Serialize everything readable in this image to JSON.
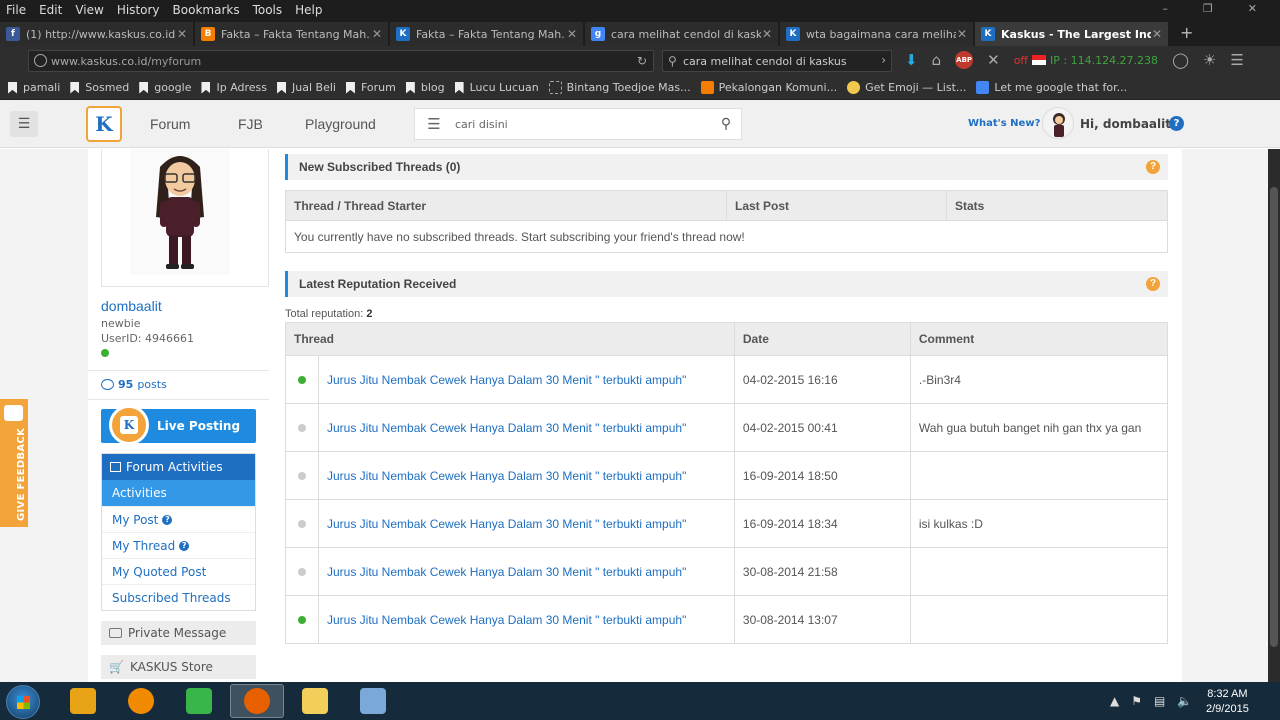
{
  "browser": {
    "menu": [
      "File",
      "Edit",
      "View",
      "History",
      "Bookmarks",
      "Tools",
      "Help"
    ],
    "tabs": [
      {
        "title": "(1) http://www.kaskus.co.id...",
        "favicon_color": "#3b5998",
        "favicon_glyph": "f",
        "active": false
      },
      {
        "title": "Fakta – Fakta Tentang Mah...",
        "favicon_color": "#f57d00",
        "favicon_glyph": "B",
        "active": false
      },
      {
        "title": "Fakta – Fakta Tentang Mah...",
        "favicon_color": "#1e6fc2",
        "favicon_glyph": "K",
        "active": false
      },
      {
        "title": "cara melihat cendol di kask...",
        "favicon_color": "#4285f4",
        "favicon_glyph": "g",
        "active": false
      },
      {
        "title": "wta bagaimana cara meliha...",
        "favicon_color": "#1e6fc2",
        "favicon_glyph": "K",
        "active": false
      },
      {
        "title": "Kaskus - The Largest Indo...",
        "favicon_color": "#1e6fc2",
        "favicon_glyph": "K",
        "active": true
      }
    ],
    "url_domain": "www.kaskus.co.id",
    "url_path": "/myforum",
    "search_query": "cara melihat cendol di kaskus",
    "ip_off": "off",
    "ip_text": "IP : 114.124.27.238",
    "bookmarks": [
      {
        "label": "pamali",
        "type": "folder"
      },
      {
        "label": "Sosmed",
        "type": "folder"
      },
      {
        "label": "google",
        "type": "folder"
      },
      {
        "label": "Ip Adress",
        "type": "folder"
      },
      {
        "label": "Jual Beli",
        "type": "folder"
      },
      {
        "label": "Forum",
        "type": "folder"
      },
      {
        "label": "blog",
        "type": "folder"
      },
      {
        "label": "Lucu Lucuan",
        "type": "folder"
      },
      {
        "label": "Bintang Toedjoe Mas...",
        "type": "page"
      },
      {
        "label": "Pekalongan Komuni...",
        "type": "blogger"
      },
      {
        "label": "Get Emoji — List...",
        "type": "emoji"
      },
      {
        "label": "Let me google that for...",
        "type": "lmgtfy"
      }
    ]
  },
  "header": {
    "logo_glyph": "K",
    "nav": [
      "Forum",
      "FJB",
      "Playground"
    ],
    "search_placeholder": "cari disini",
    "whats_new": "What's New?",
    "greeting": "Hi, dombaalit",
    "help": "?"
  },
  "feedback": {
    "label": "GIVE FEEDBACK"
  },
  "sidebar": {
    "username": "dombaalit",
    "rank": "newbie",
    "user_id": "UserID: 4946661",
    "posts_count": "95",
    "posts_label": "posts",
    "live_posting": "Live Posting",
    "menu_header": "Forum Activities",
    "menu_items": [
      {
        "label": "Activities",
        "active": true,
        "help": false
      },
      {
        "label": "My Post",
        "active": false,
        "help": true
      },
      {
        "label": "My Thread",
        "active": false,
        "help": true
      },
      {
        "label": "My Quoted Post",
        "active": false,
        "help": false
      },
      {
        "label": "Subscribed Threads",
        "active": false,
        "help": false
      }
    ],
    "private_message": "Private Message",
    "kaskus_store": "KASKUS Store"
  },
  "subscribed": {
    "title": "New Subscribed Threads (0)",
    "columns": [
      "Thread / Thread Starter",
      "Last Post",
      "Stats"
    ],
    "empty_text": "You currently have no subscribed threads. Start subscribing your friend's thread now!"
  },
  "reputation": {
    "title": "Latest Reputation Received",
    "total_label": "Total reputation:",
    "total_value": "2",
    "columns": [
      "Thread",
      "Date",
      "Comment"
    ],
    "rows": [
      {
        "dot": "#3cb034",
        "thread": "Jurus Jitu Nembak Cewek Hanya Dalam 30 Menit \" terbukti ampuh\"",
        "date": "04-02-2015 16:16",
        "comment": ".-Bin3r4"
      },
      {
        "dot": "#cccccc",
        "thread": "Jurus Jitu Nembak Cewek Hanya Dalam 30 Menit \" terbukti ampuh\"",
        "date": "04-02-2015 00:41",
        "comment": "Wah gua butuh banget nih gan thx ya gan"
      },
      {
        "dot": "#cccccc",
        "thread": "Jurus Jitu Nembak Cewek Hanya Dalam 30 Menit \" terbukti ampuh\"",
        "date": "16-09-2014 18:50",
        "comment": ""
      },
      {
        "dot": "#cccccc",
        "thread": "Jurus Jitu Nembak Cewek Hanya Dalam 30 Menit \" terbukti ampuh\"",
        "date": "16-09-2014 18:34",
        "comment": "isi kulkas :D"
      },
      {
        "dot": "#cccccc",
        "thread": "Jurus Jitu Nembak Cewek Hanya Dalam 30 Menit \" terbukti ampuh\"",
        "date": "30-08-2014 21:58",
        "comment": ""
      },
      {
        "dot": "#3cb034",
        "thread": "Jurus Jitu Nembak Cewek Hanya Dalam 30 Menit \" terbukti ampuh\"",
        "date": "30-08-2014 13:07",
        "comment": ""
      }
    ]
  },
  "taskbar": {
    "apps": [
      {
        "name": "winamp",
        "color": "#e8a317",
        "active": false
      },
      {
        "name": "vlc",
        "color": "#f08a00",
        "active": false
      },
      {
        "name": "clover",
        "color": "#39b54a",
        "active": false
      },
      {
        "name": "firefox",
        "color": "#e66000",
        "active": true
      },
      {
        "name": "explorer",
        "color": "#f2cf5b",
        "active": false
      },
      {
        "name": "paint",
        "color": "#7aa9d9",
        "active": false
      }
    ],
    "time": "8:32 AM",
    "date": "2/9/2015"
  }
}
